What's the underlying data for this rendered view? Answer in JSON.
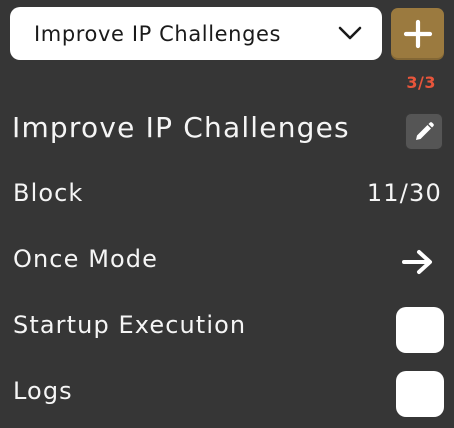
{
  "selector": {
    "selected_value": "Improve IP Challenges",
    "dropdown_icon": "chevron-down-icon"
  },
  "add_button": {
    "icon": "plus-icon",
    "color": "#9b7a3f"
  },
  "counter": "3/3",
  "profile": {
    "name": "Improve IP Challenges",
    "edit_icon": "pencil-icon"
  },
  "settings": {
    "block": {
      "label": "Block",
      "value": "11/30"
    },
    "once_mode": {
      "label": "Once Mode",
      "icon": "arrow-right-icon"
    },
    "startup_execution": {
      "label": "Startup Execution",
      "checked": false
    },
    "logs": {
      "label": "Logs",
      "checked": false
    }
  },
  "colors": {
    "background": "#363636",
    "accent_gold": "#9b7a3f",
    "counter_red": "#e8553b"
  }
}
